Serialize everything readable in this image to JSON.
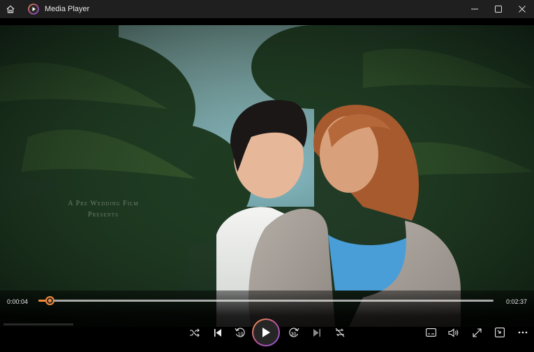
{
  "window": {
    "title": "Media Player"
  },
  "video": {
    "overlay_line1": "A Pre Wedding Film",
    "overlay_line2": "Presents"
  },
  "playback": {
    "current_time": "0:00:04",
    "duration": "0:02:37",
    "progress": 0.025
  },
  "controls": {
    "skip_back_seconds": "10",
    "skip_forward_seconds": "30"
  },
  "colors": {
    "accent": "#f08a3c",
    "titlebar": "#1f1f1f"
  },
  "icons": [
    "home-icon",
    "media-player-app-icon",
    "minimize-icon",
    "maximize-icon",
    "close-icon",
    "shuffle-icon",
    "previous-icon",
    "skip-back-icon",
    "play-icon",
    "skip-forward-icon",
    "next-icon",
    "repeat-icon",
    "captions-icon",
    "volume-icon",
    "fullscreen-icon",
    "miniplayer-icon",
    "more-icon"
  ]
}
